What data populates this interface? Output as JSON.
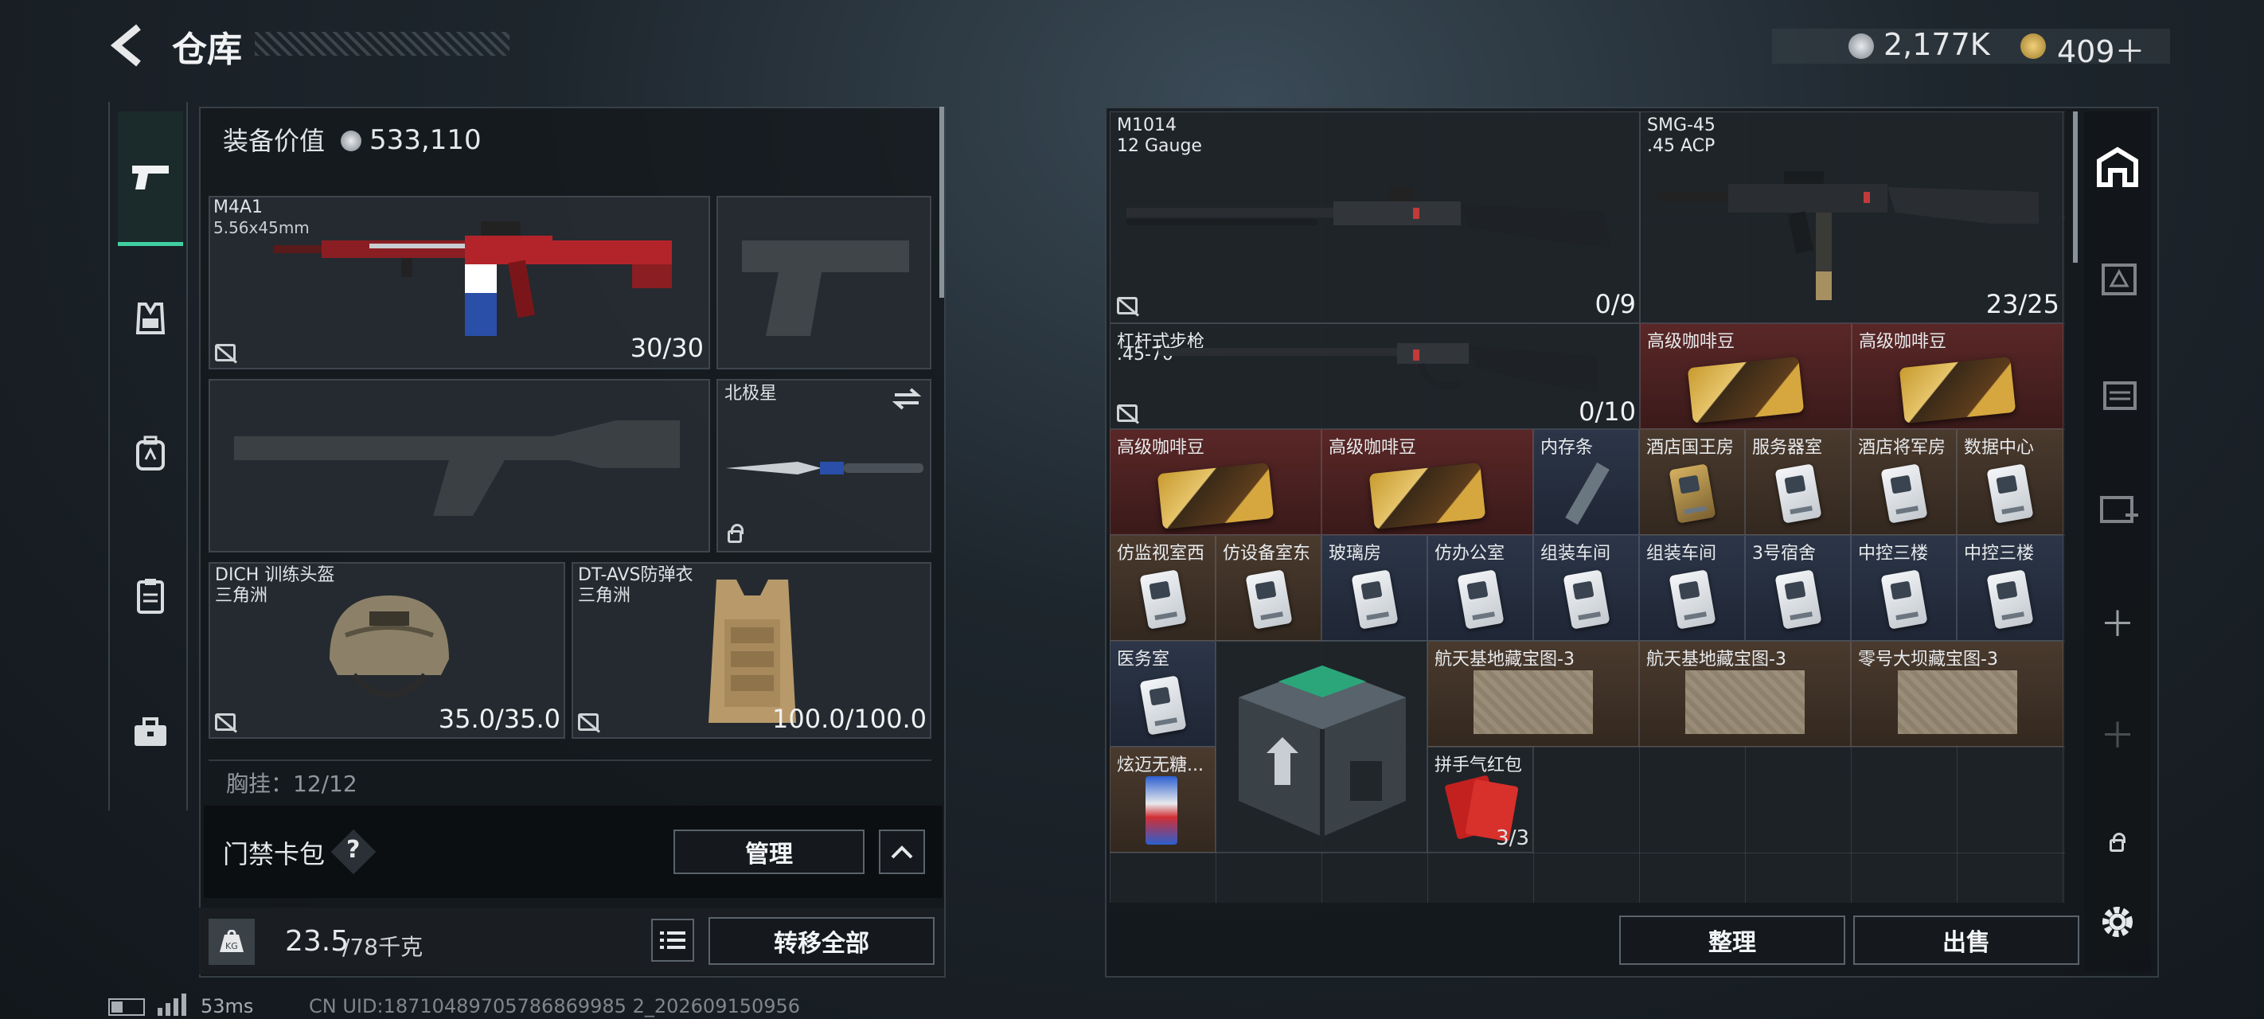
{
  "header": {
    "title": "仓库",
    "currency": "2,177K",
    "premium": "409＋"
  },
  "left": {
    "equip_value_label": "装备价值",
    "equip_value": "533,110",
    "primary": {
      "name": "M4A1",
      "caliber": "5.56x45mm",
      "ammo": "30/30"
    },
    "melee": {
      "name": "北极星"
    },
    "helmet": {
      "name": "DICH 训练头盔",
      "sub": "三角洲",
      "durability": "35.0/35.0"
    },
    "armor": {
      "name": "DT-AVS防弹衣",
      "sub": "三角洲",
      "durability": "100.0/100.0"
    },
    "chest_partial": "胸挂：12/12",
    "keycard": {
      "label": "门禁卡包",
      "help": "?",
      "manage": "管理"
    },
    "weight": {
      "value": "23.5",
      "max": "/78千克",
      "transfer": "转移全部"
    }
  },
  "grid": {
    "m1014": {
      "name": "M1014",
      "caliber": "12 Gauge",
      "ammo": "0/9"
    },
    "smg45": {
      "name": "SMG-45",
      "caliber": ".45 ACP",
      "ammo": "23/25"
    },
    "lever": {
      "name": "杠杆式步枪",
      "caliber": ".45-70",
      "ammo": "0/10"
    },
    "coffee": "高级咖啡豆",
    "ram": "内存条",
    "hotel_king": "酒店国王房",
    "service": "服务器室",
    "hotel_gen": "酒店将军房",
    "datacenter": "数据中心",
    "fake_monitor": "仿监视室西",
    "fake_equip": "仿设备室东",
    "glass": "玻璃房",
    "fake_office": "仿办公室",
    "assembly1": "组装车间",
    "assembly2": "组装车间",
    "dorm3": "3号宿舍",
    "central1": "中控三楼",
    "central2": "中控三楼",
    "medical": "医务室",
    "aero1": "航天基地藏宝图-3",
    "aero2": "航天基地藏宝图-3",
    "zero_map": "零号大坝藏宝图-3",
    "candy": "炫迈无糖...",
    "redpacket": "拼手气红包",
    "redpacket_count": "3/3",
    "sort": "整理",
    "sell": "出售"
  },
  "status": {
    "ping": "53ms",
    "uid": "CN UID:18710489705786869985 2_202609150956"
  }
}
